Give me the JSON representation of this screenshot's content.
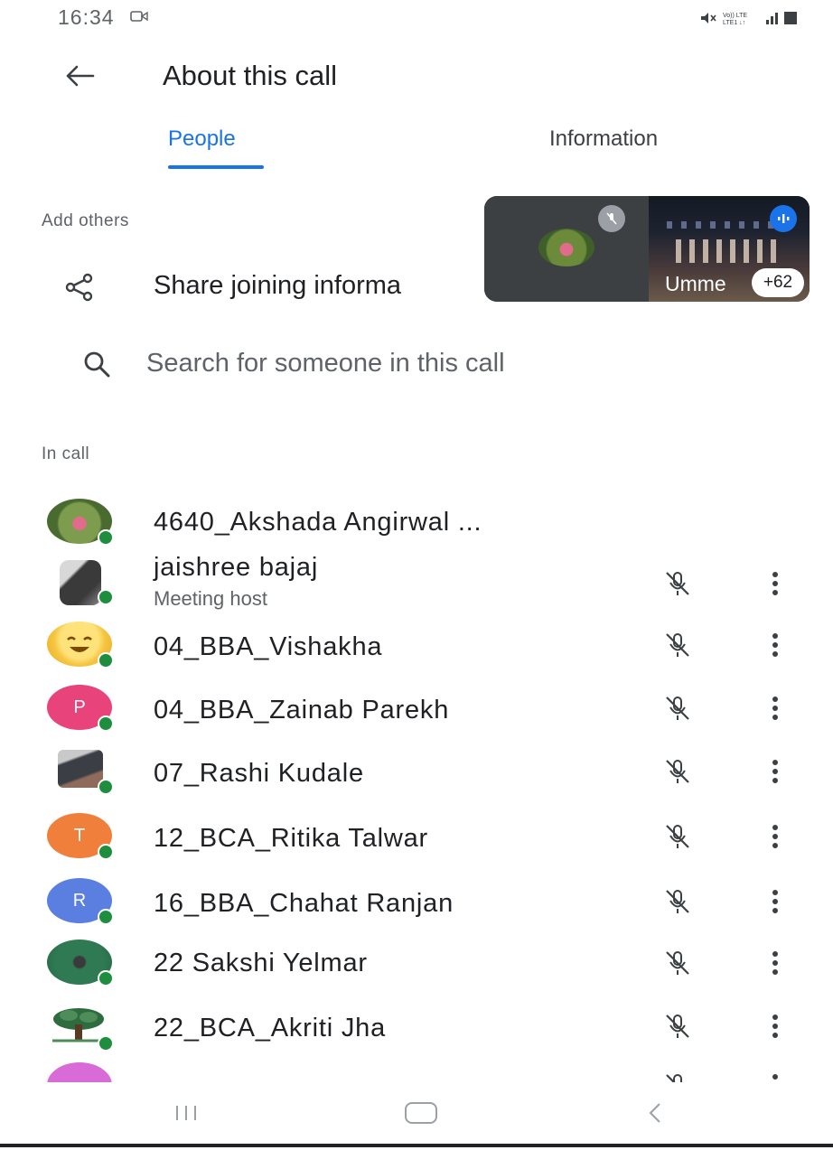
{
  "status_bar": {
    "time": "16:34"
  },
  "app_bar": {
    "title": "About this call"
  },
  "tabs": [
    {
      "label": "People",
      "selected": true
    },
    {
      "label": "Information",
      "selected": false
    }
  ],
  "add_others": {
    "section_label": "Add others",
    "share_label": "Share joining informa",
    "search_placeholder": "Search for someone in this call"
  },
  "pip": {
    "name": "Umme",
    "count": "+62"
  },
  "in_call": {
    "section_label": "In call",
    "participants": [
      {
        "name": "4640_Akshada Angirwal ...",
        "subtitle": "",
        "avatar_type": "photo",
        "avatar_letter": ""
      },
      {
        "name": "jaishree bajaj",
        "subtitle": "Meeting host",
        "avatar_type": "photo",
        "avatar_letter": ""
      },
      {
        "name": "04_BBA_Vishakha",
        "subtitle": "",
        "avatar_type": "emoji",
        "avatar_letter": ""
      },
      {
        "name": "04_BBA_Zainab Parekh",
        "subtitle": "",
        "avatar_type": "letter",
        "avatar_letter": "P",
        "color": "#e8437a"
      },
      {
        "name": "07_Rashi Kudale",
        "subtitle": "",
        "avatar_type": "photo",
        "avatar_letter": ""
      },
      {
        "name": "12_BCA_Ritika Talwar",
        "subtitle": "",
        "avatar_type": "letter",
        "avatar_letter": "T",
        "color": "#f07f3c"
      },
      {
        "name": "16_BBA_Chahat Ranjan",
        "subtitle": "",
        "avatar_type": "letter",
        "avatar_letter": "R",
        "color": "#5b7fe0"
      },
      {
        "name": "22 Sakshi Yelmar",
        "subtitle": "",
        "avatar_type": "photo",
        "avatar_letter": ""
      },
      {
        "name": "22_BCA_Akriti Jha",
        "subtitle": "",
        "avatar_type": "photo",
        "avatar_letter": ""
      }
    ]
  },
  "colors": {
    "accent": "#1a73e8",
    "online": "#1e8e3e"
  }
}
